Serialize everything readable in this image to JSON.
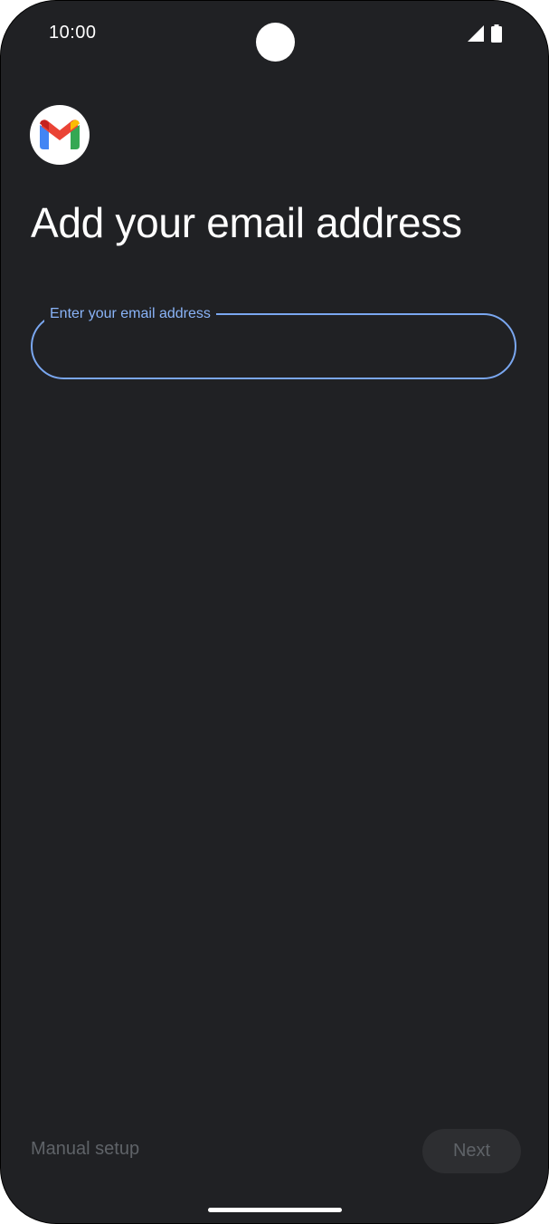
{
  "status_bar": {
    "time": "10:00",
    "icons": [
      "signal-icon",
      "battery-icon"
    ]
  },
  "app": {
    "logo_icon": "gmail-logo-icon"
  },
  "page": {
    "title": "Add your email address"
  },
  "email_field": {
    "label": "Enter your email address",
    "value": ""
  },
  "actions": {
    "manual_setup_label": "Manual setup",
    "next_label": "Next"
  },
  "colors": {
    "background": "#202124",
    "accent": "#8ab4f8",
    "disabled_text": "#5f6368",
    "disabled_button": "#2d2e31",
    "gmail_red": "#ea4335",
    "gmail_blue": "#4285f4",
    "gmail_green": "#34a853",
    "gmail_yellow": "#fbbc04",
    "gmail_dark_red": "#c5221f"
  }
}
